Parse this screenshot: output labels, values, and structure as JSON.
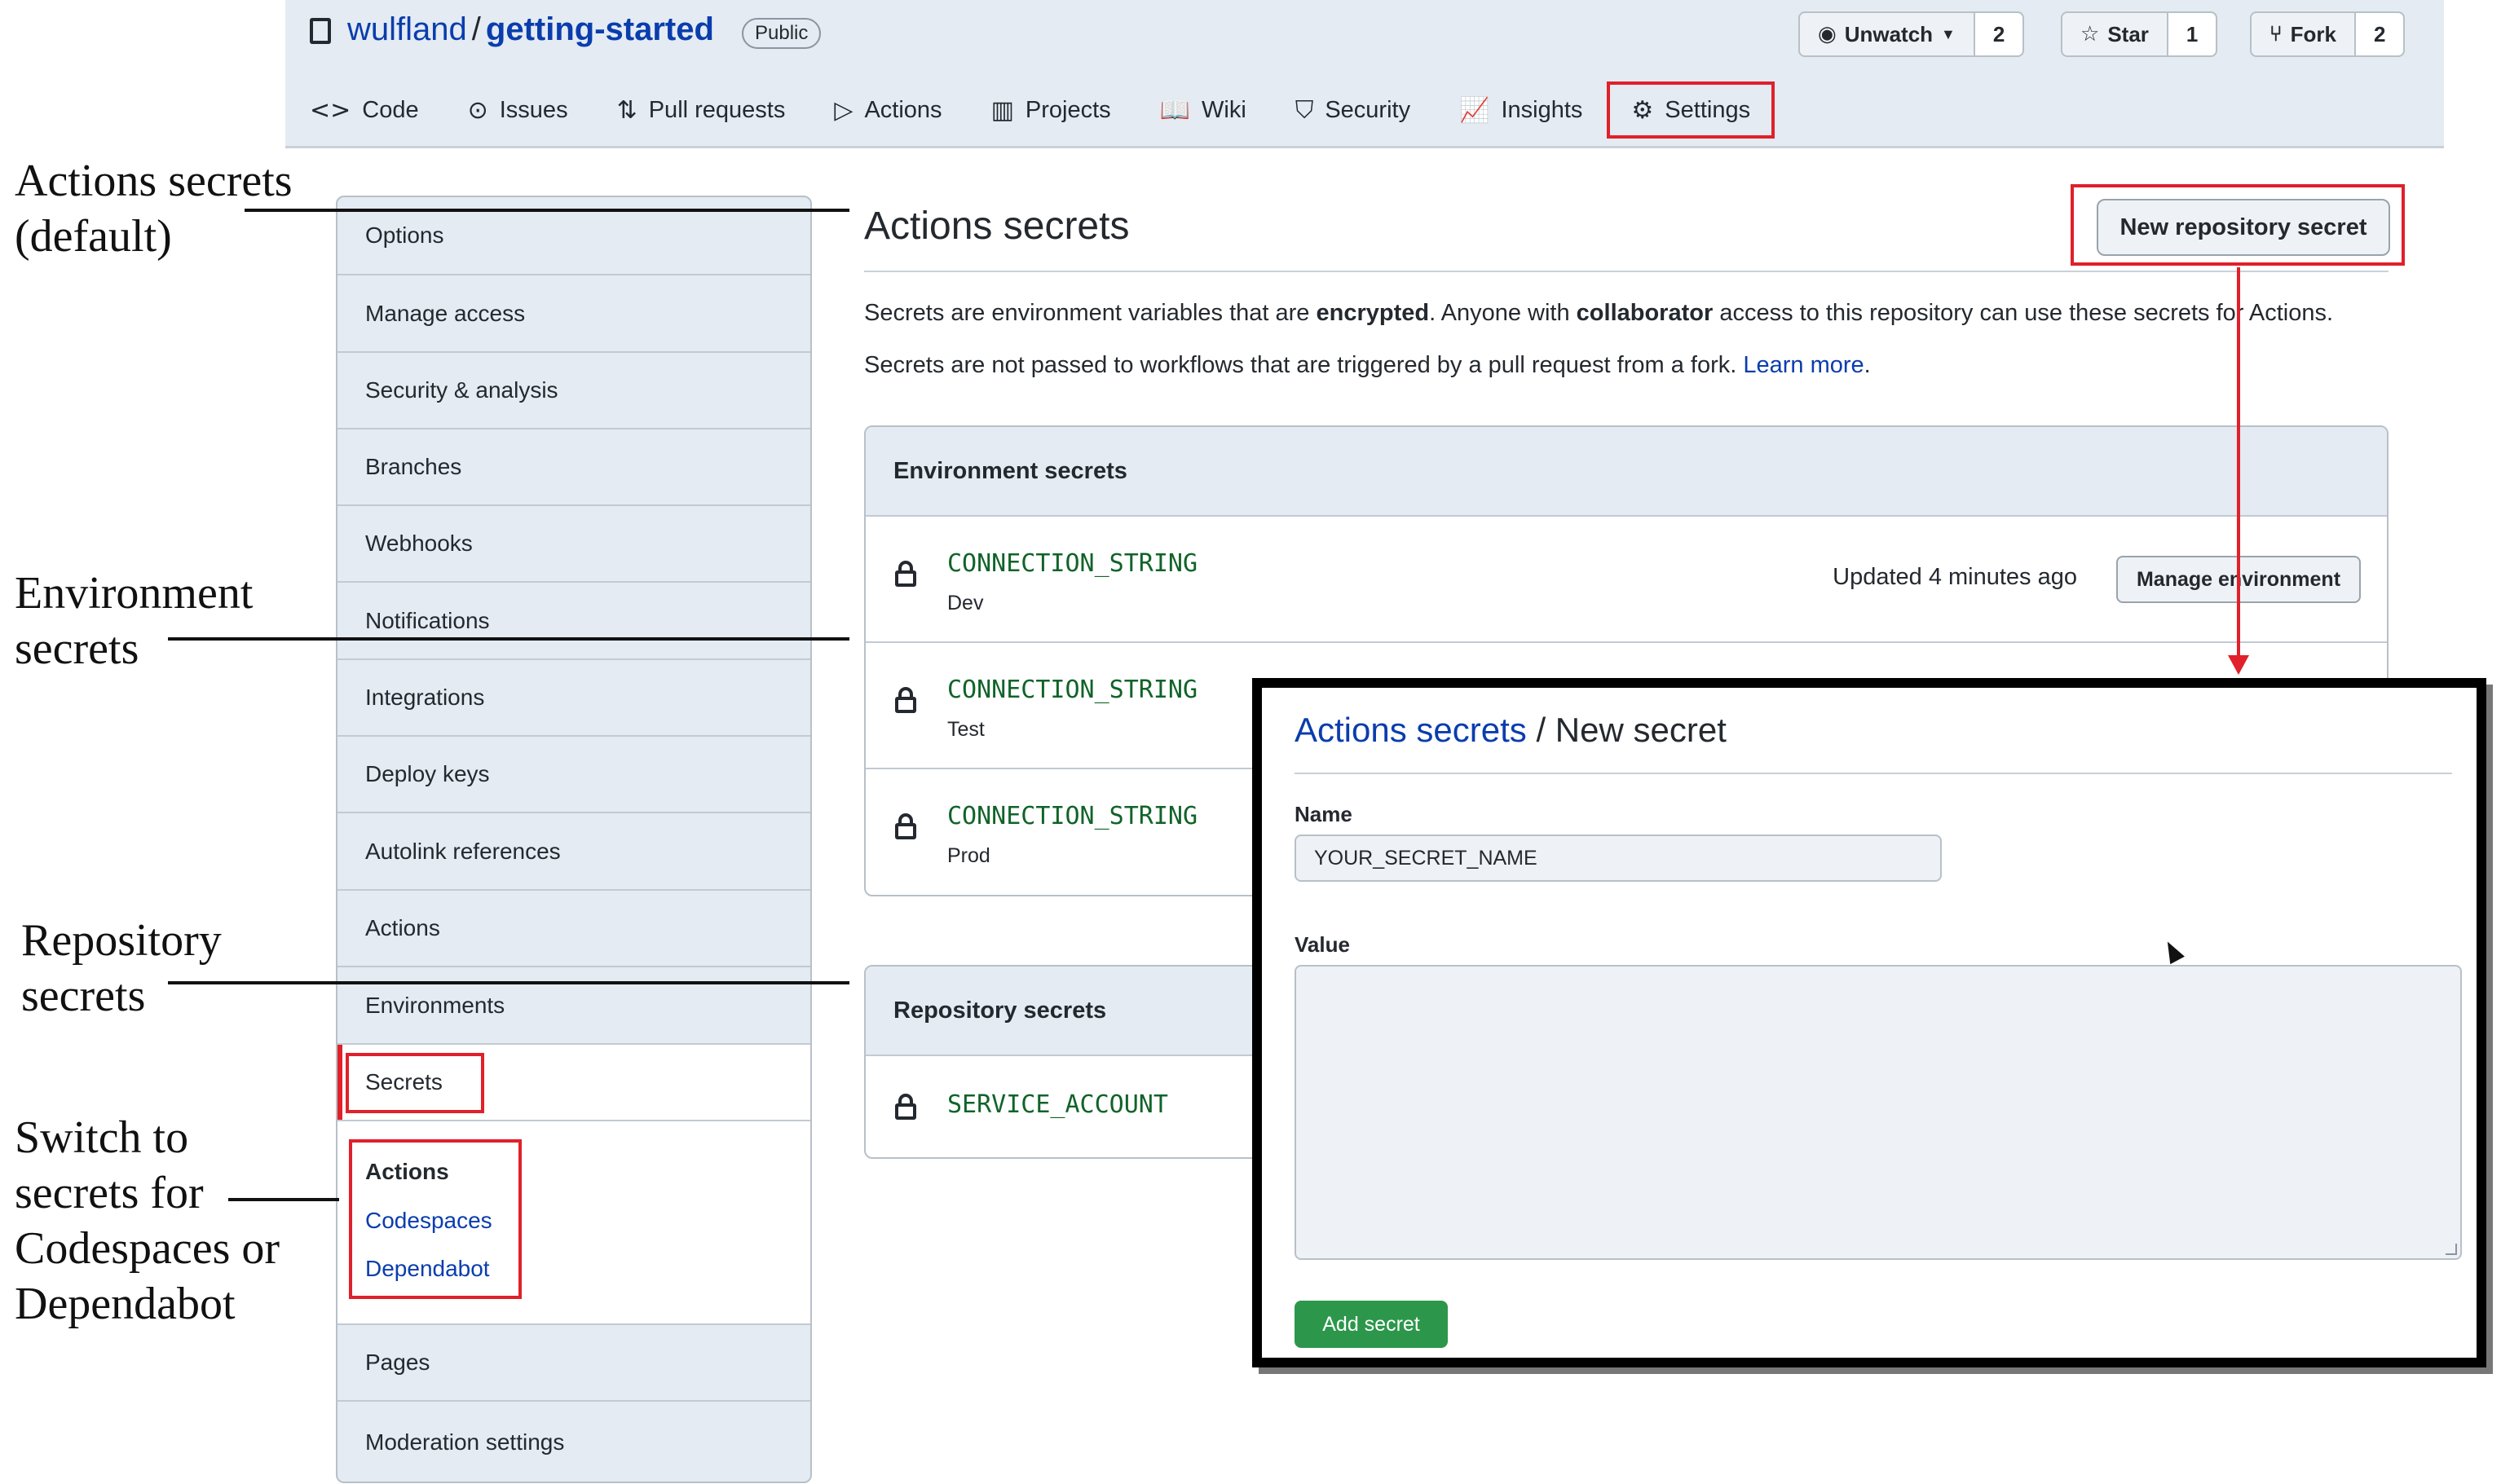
{
  "repo": {
    "owner": "wulfland",
    "separator": "/",
    "name": "getting-started",
    "visibility": "Public",
    "watch": {
      "label": "Unwatch",
      "count": "2",
      "icon": "eye-icon"
    },
    "star": {
      "label": "Star",
      "count": "1",
      "icon": "star-icon"
    },
    "fork": {
      "label": "Fork",
      "count": "2",
      "icon": "fork-icon"
    }
  },
  "tabs": [
    {
      "label": "Code",
      "icon": "<>"
    },
    {
      "label": "Issues",
      "icon": "⊙"
    },
    {
      "label": "Pull requests",
      "icon": "⇅"
    },
    {
      "label": "Actions",
      "icon": "▷"
    },
    {
      "label": "Projects",
      "icon": "▥"
    },
    {
      "label": "Wiki",
      "icon": "📖"
    },
    {
      "label": "Security",
      "icon": "⛉"
    },
    {
      "label": "Insights",
      "icon": "📈"
    },
    {
      "label": "Settings",
      "icon": "⚙"
    }
  ],
  "sidebar": {
    "items": [
      "Options",
      "Manage access",
      "Security & analysis",
      "Branches",
      "Webhooks",
      "Notifications",
      "Integrations",
      "Deploy keys",
      "Autolink references",
      "Actions",
      "Environments",
      "Secrets"
    ],
    "sub_items": [
      "Actions",
      "Codespaces",
      "Dependabot"
    ],
    "footer_items": [
      "Pages",
      "Moderation settings"
    ]
  },
  "main": {
    "title": "Actions secrets",
    "new_button": "New repository secret",
    "desc1": {
      "p1": "Secrets are environment variables that are ",
      "b1": "encrypted",
      "p2": ". Anyone with ",
      "b2": "collaborator",
      "p3": " access to this repository can use these secrets for Actions."
    },
    "desc2": {
      "text": "Secrets are not passed to workflows that are triggered by a pull request from a fork. ",
      "link": "Learn more",
      "end": "."
    },
    "env_panel": {
      "title": "Environment secrets",
      "rows": [
        {
          "name": "CONNECTION_STRING",
          "env": "Dev",
          "updated": "Updated 4 minutes ago",
          "action": "Manage environment"
        },
        {
          "name": "CONNECTION_STRING",
          "env": "Test"
        },
        {
          "name": "CONNECTION_STRING",
          "env": "Prod"
        }
      ]
    },
    "repo_panel": {
      "title": "Repository secrets",
      "rows": [
        {
          "name": "SERVICE_ACCOUNT"
        }
      ]
    }
  },
  "dialog": {
    "breadcrumb_link": "Actions secrets",
    "breadcrumb_sep": " / ",
    "breadcrumb_current": "New secret",
    "name_label": "Name",
    "name_value": "YOUR_SECRET_NAME",
    "value_label": "Value",
    "submit": "Add secret"
  },
  "annotations": {
    "actions_secrets": [
      "Actions secrets",
      "(default)"
    ],
    "environment_secrets": [
      "Environment",
      "secrets"
    ],
    "repository_secrets": [
      "Repository",
      "secrets"
    ],
    "switch": [
      "Switch to",
      "secrets for",
      "Codespaces or",
      "Dependabot"
    ]
  },
  "colors": {
    "highlight": "#e0202a",
    "link": "#0a3dad",
    "secret_name": "#116329",
    "submit": "#2c974b"
  }
}
